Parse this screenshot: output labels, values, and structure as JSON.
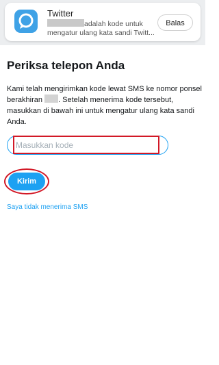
{
  "notification": {
    "app_name": "Twitter",
    "icon": "twitter-chat-bubble-icon",
    "message_line1": "adalah kode untuk",
    "message_line2": "mengatur ulang kata sandi Twitt...",
    "reply_label": "Balas"
  },
  "page": {
    "title": "Periksa telepon Anda",
    "instructions_before": "Kami telah mengirimkan kode lewat SMS ke nomor ponsel berakhiran ",
    "instructions_after": ". Setelah menerima kode tersebut, masukkan di bawah ini untuk mengatur ulang kata sandi Anda."
  },
  "code_field": {
    "placeholder": "Masukkan kode",
    "value": ""
  },
  "submit_label": "Kirim",
  "no_sms_link": "Saya tidak menerima SMS",
  "colors": {
    "accent": "#1da1f2",
    "highlight": "#d21826",
    "icon_bg": "#3fa2e6"
  }
}
